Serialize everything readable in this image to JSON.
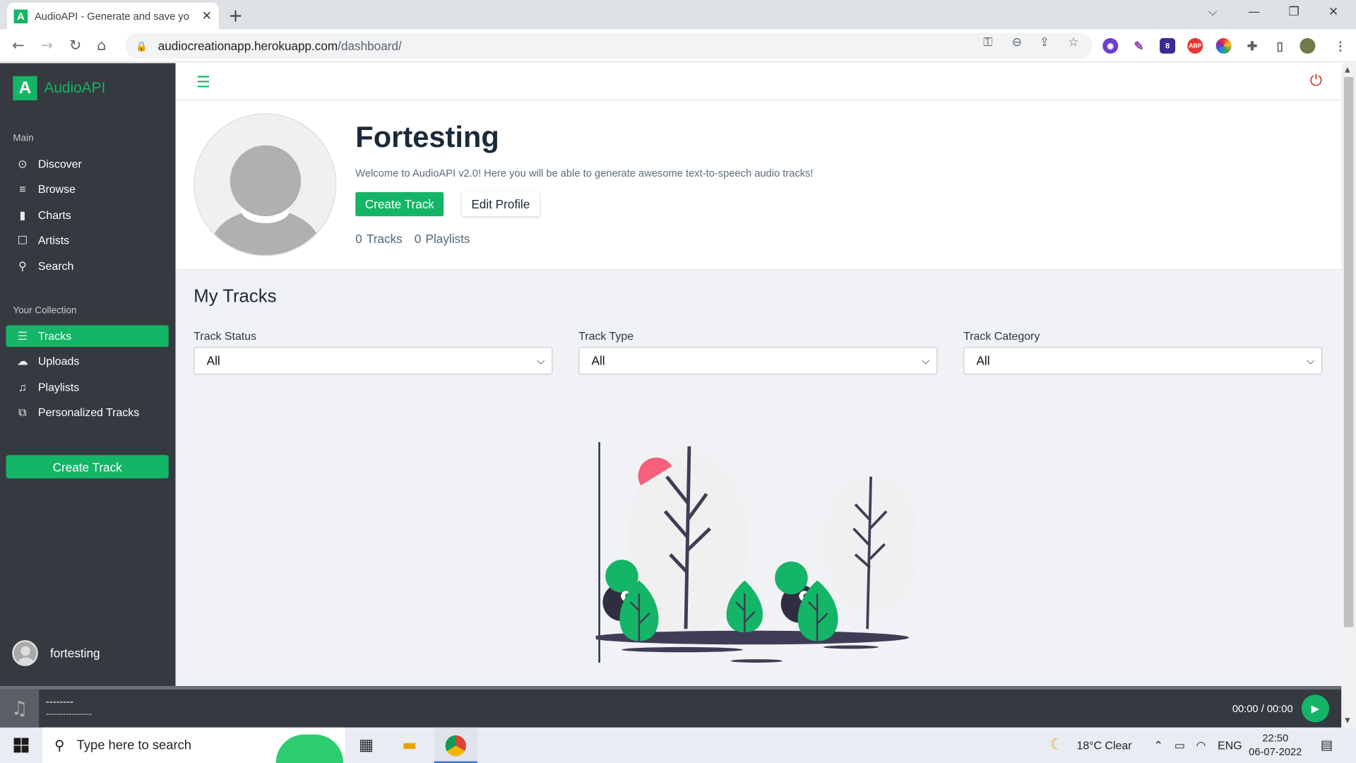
{
  "browser": {
    "tab_title": "AudioAPI - Generate and save yo",
    "tab_favicon": "A",
    "url_host": "audiocreationapp.herokuapp.com",
    "url_path": "/dashboard/",
    "extension_badge": "8",
    "extension_abp": "ABP"
  },
  "brand": {
    "logo_letter": "A",
    "name": "AudioAPI",
    "accent": "#14b566"
  },
  "sidebar": {
    "main_heading": "Main",
    "main_items": [
      {
        "label": "Discover",
        "icon": "play-circle-icon"
      },
      {
        "label": "Browse",
        "icon": "browse-lines-icon"
      },
      {
        "label": "Charts",
        "icon": "bar-chart-icon"
      },
      {
        "label": "Artists",
        "icon": "artist-icon"
      },
      {
        "label": "Search",
        "icon": "search-icon"
      }
    ],
    "collection_heading": "Your Collection",
    "collection_items": [
      {
        "label": "Tracks",
        "icon": "list-icon",
        "active": true
      },
      {
        "label": "Uploads",
        "icon": "upload-cloud-icon"
      },
      {
        "label": "Playlists",
        "icon": "playlist-icon"
      },
      {
        "label": "Personalized Tracks",
        "icon": "library-icon"
      }
    ],
    "create_button": "Create Track",
    "username": "fortesting"
  },
  "profile": {
    "name": "Fortesting",
    "welcome": "Welcome to AudioAPI v2.0! Here you will be able to generate awesome text-to-speech audio tracks!",
    "create_button": "Create Track",
    "edit_button": "Edit Profile",
    "tracks_count": "0",
    "tracks_label": "Tracks",
    "playlists_count": "0",
    "playlists_label": "Playlists"
  },
  "tracks": {
    "title": "My Tracks",
    "filters": [
      {
        "label": "Track Status",
        "value": "All"
      },
      {
        "label": "Track Type",
        "value": "All"
      },
      {
        "label": "Track Category",
        "value": "All"
      }
    ]
  },
  "player": {
    "title": "--------",
    "subtitle": "----------------",
    "time": "00:00 / 00:00"
  },
  "taskbar": {
    "search_placeholder": "Type here to search",
    "weather": "18°C  Clear",
    "language": "ENG",
    "time": "22:50",
    "date": "06-07-2022"
  }
}
